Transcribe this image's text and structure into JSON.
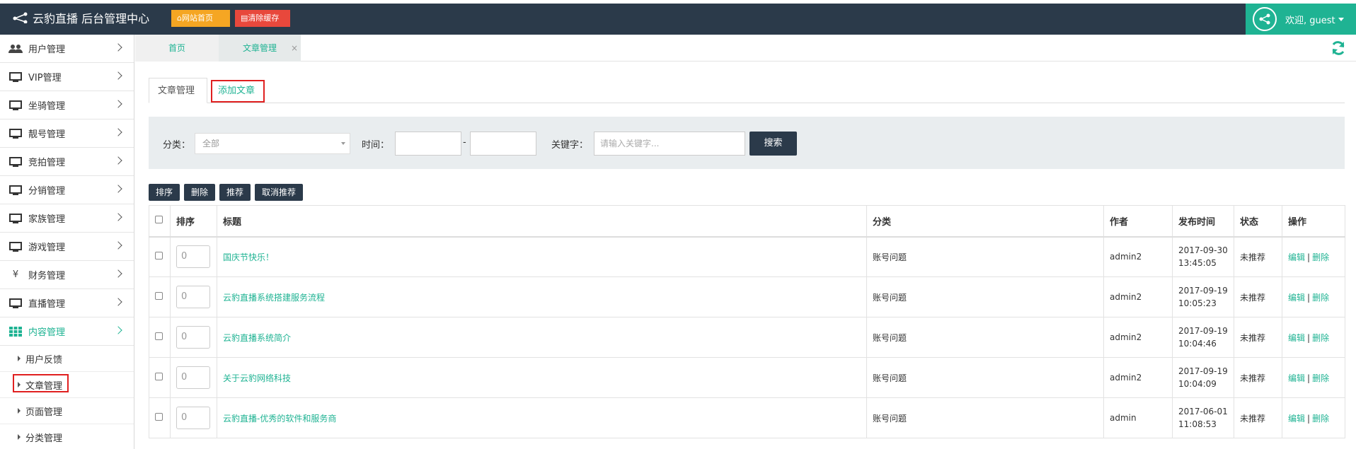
{
  "header": {
    "brand": "云豹直播 后台管理中心",
    "home_button": "网站首页",
    "clear_cache_button": "清除缓存",
    "welcome": "欢迎, guest",
    "colors": {
      "bar": "#2b3a4a",
      "accent": "#1fb393",
      "orange": "#f5a623",
      "red": "#e8483c"
    }
  },
  "sidebar": {
    "items": [
      {
        "label": "用户管理",
        "icon": "users-icon"
      },
      {
        "label": "VIP管理",
        "icon": "monitor-icon"
      },
      {
        "label": "坐骑管理",
        "icon": "monitor-icon"
      },
      {
        "label": "靓号管理",
        "icon": "monitor-icon"
      },
      {
        "label": "竞拍管理",
        "icon": "monitor-icon"
      },
      {
        "label": "分销管理",
        "icon": "monitor-icon"
      },
      {
        "label": "家族管理",
        "icon": "monitor-icon"
      },
      {
        "label": "游戏管理",
        "icon": "monitor-icon"
      },
      {
        "label": "财务管理",
        "icon": "yen-icon"
      },
      {
        "label": "直播管理",
        "icon": "monitor-icon"
      },
      {
        "label": "内容管理",
        "icon": "grid-icon"
      }
    ],
    "subitems": [
      "用户反馈",
      "文章管理",
      "页面管理",
      "分类管理"
    ]
  },
  "tabs": {
    "home": "首页",
    "current": "文章管理",
    "close": "×"
  },
  "content_tabs": {
    "list": "文章管理",
    "add": "添加文章"
  },
  "filter": {
    "category_label": "分类：",
    "category_value": "全部",
    "time_label": "时间：",
    "dash": "-",
    "keyword_label": "关键字：",
    "keyword_placeholder": "请输入关键字...",
    "search_button": "搜索"
  },
  "actions": {
    "sort": "排序",
    "delete": "删除",
    "recommend": "推荐",
    "unrecommend": "取消推荐"
  },
  "table": {
    "headers": {
      "order": "排序",
      "title": "标题",
      "category": "分类",
      "author": "作者",
      "time": "发布时间",
      "status": "状态",
      "ops": "操作"
    },
    "edit": "编辑",
    "del": "删除",
    "pipe": "|",
    "rows": [
      {
        "order": "0",
        "title": "国庆节快乐！",
        "category": "账号问题",
        "author": "admin2",
        "date": "2017-09-30",
        "time": "13:45:05",
        "status": "未推荐"
      },
      {
        "order": "0",
        "title": "云豹直播系统搭建服务流程",
        "category": "账号问题",
        "author": "admin2",
        "date": "2017-09-19",
        "time": "10:05:23",
        "status": "未推荐"
      },
      {
        "order": "0",
        "title": "云豹直播系统简介",
        "category": "账号问题",
        "author": "admin2",
        "date": "2017-09-19",
        "time": "10:04:46",
        "status": "未推荐"
      },
      {
        "order": "0",
        "title": "关于云豹网络科技",
        "category": "账号问题",
        "author": "admin2",
        "date": "2017-09-19",
        "time": "10:04:09",
        "status": "未推荐"
      },
      {
        "order": "0",
        "title": "云豹直播-优秀的软件和服务商",
        "category": "账号问题",
        "author": "admin",
        "date": "2017-06-01",
        "time": "11:08:53",
        "status": "未推荐"
      }
    ]
  }
}
